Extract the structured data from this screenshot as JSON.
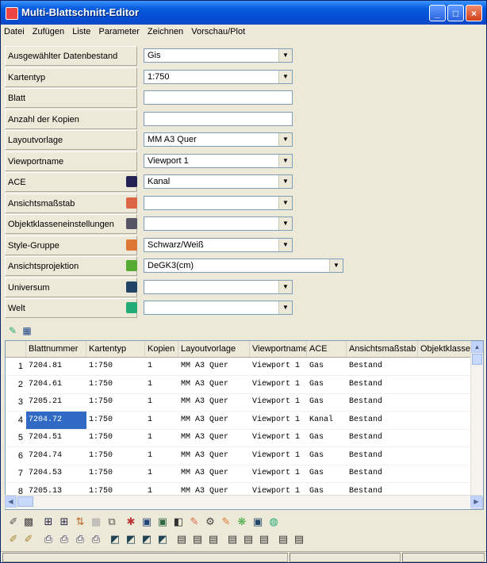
{
  "window": {
    "title": "Multi-Blattschnitt-Editor"
  },
  "menu": [
    "Datei",
    "Zufügen",
    "Liste",
    "Parameter",
    "Zeichnen",
    "Vorschau/Plot"
  ],
  "form": [
    {
      "label": "Ausgewählter Datenbestand",
      "value": "Gis",
      "dropdown": true
    },
    {
      "label": "Kartentyp",
      "value": "1:750",
      "dropdown": true
    },
    {
      "label": "Blatt",
      "value": "",
      "dropdown": false
    },
    {
      "label": "Anzahl der Kopien",
      "value": "",
      "dropdown": false
    },
    {
      "label": "Layoutvorlage",
      "value": "MM A3 Quer",
      "dropdown": true
    },
    {
      "label": "Viewportname",
      "value": "Viewport 1",
      "dropdown": true
    },
    {
      "label": "ACE",
      "value": "Kanal",
      "dropdown": true
    },
    {
      "label": "Ansichtsmaßstab",
      "value": "",
      "dropdown": true
    },
    {
      "label": "Objektklasseneinstellungen",
      "value": "",
      "dropdown": true
    },
    {
      "label": "Style-Gruppe",
      "value": "Schwarz/Weiß",
      "dropdown": true
    },
    {
      "label": "Ansichtsprojektion",
      "value": "DeGK3(cm)",
      "dropdown": true
    },
    {
      "label": "Universum",
      "value": "",
      "dropdown": true
    },
    {
      "label": "Welt",
      "value": "",
      "dropdown": true
    }
  ],
  "table": {
    "columns": [
      "Blattnummer",
      "Kartentyp",
      "Kopien",
      "Layoutvorlage",
      "Viewportname",
      "ACE",
      "Ansichtsmaßstab",
      "Objektklassene"
    ],
    "rows": [
      {
        "n": "1",
        "cells": [
          "7204.81",
          "1:750",
          "1",
          "MM A3 Quer",
          "Viewport 1",
          "Gas",
          "Bestand",
          ""
        ]
      },
      {
        "n": "2",
        "cells": [
          "7204.61",
          "1:750",
          "1",
          "MM A3 Quer",
          "Viewport 1",
          "Gas",
          "Bestand",
          ""
        ]
      },
      {
        "n": "3",
        "cells": [
          "7205.21",
          "1:750",
          "1",
          "MM A3 Quer",
          "Viewport 1",
          "Gas",
          "Bestand",
          ""
        ]
      },
      {
        "n": "4",
        "cells": [
          "7204.72",
          "1:750",
          "1",
          "MM A3 Quer",
          "Viewport 1",
          "Kanal",
          "Bestand",
          ""
        ]
      },
      {
        "n": "5",
        "cells": [
          "7204.51",
          "1:750",
          "1",
          "MM A3 Quer",
          "Viewport 1",
          "Gas",
          "Bestand",
          ""
        ]
      },
      {
        "n": "6",
        "cells": [
          "7204.74",
          "1:750",
          "1",
          "MM A3 Quer",
          "Viewport 1",
          "Gas",
          "Bestand",
          ""
        ]
      },
      {
        "n": "7",
        "cells": [
          "7204.53",
          "1:750",
          "1",
          "MM A3 Quer",
          "Viewport 1",
          "Gas",
          "Bestand",
          ""
        ]
      },
      {
        "n": "8",
        "cells": [
          "7205.13",
          "1:750",
          "1",
          "MM A3 Quer",
          "Viewport 1",
          "Gas",
          "Bestand",
          ""
        ]
      }
    ]
  },
  "colors": {
    "titlebar": "#0a5fe0",
    "selection": "#316ac5",
    "face": "#ece9d8"
  }
}
